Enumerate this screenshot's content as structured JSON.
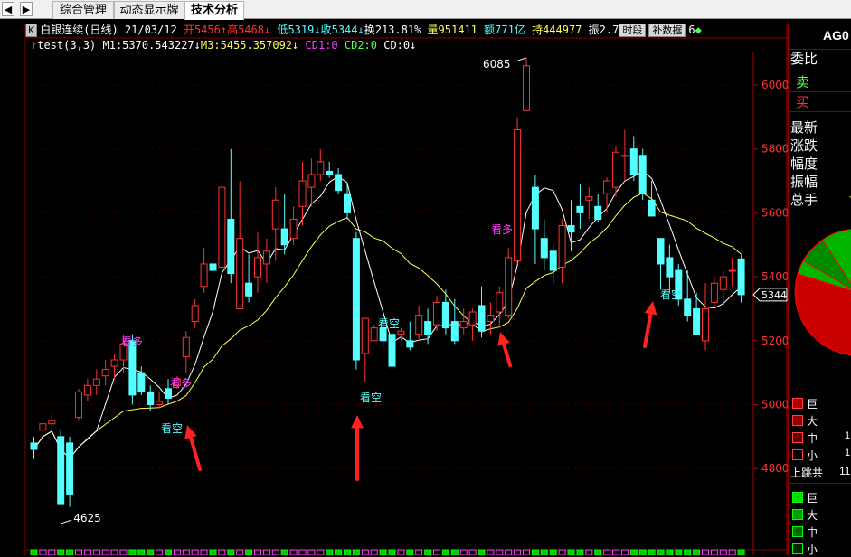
{
  "tabs": {
    "nav_left": "◀",
    "nav_right": "▶",
    "items": [
      {
        "label": "综合管理"
      },
      {
        "label": "动态显示牌"
      },
      {
        "label": "技术分析"
      }
    ]
  },
  "header": {
    "k_badge": "K",
    "instrument": "白银连续(日线)",
    "date": "21/03/12",
    "open": "开5456",
    "high": "高5468",
    "low": "低5319",
    "close": "收5344",
    "turnover_rate": "换213.81%",
    "volume": "量951411",
    "amount": "额771亿",
    "open_interest": "持444977",
    "amplitude": "振2.7",
    "time_btn": "时段",
    "supplement_btn": "补数据",
    "extra": "6"
  },
  "indicator": {
    "name": "test(3,3)",
    "m1": "M1:5370.543227",
    "m3": "M3:5455.357092",
    "cd1": "CD1:0",
    "cd2": "CD2:0",
    "cd": "CD:0"
  },
  "chart": {
    "y_ticks": [
      "6000",
      "5800",
      "5600",
      "5400",
      "5200",
      "5000",
      "4800"
    ],
    "current_price": "5344",
    "max_label": "6085",
    "min_label": "4625",
    "signals": [
      {
        "text": "看多"
      },
      {
        "text": "看空"
      },
      {
        "text": "看多"
      },
      {
        "text": "看空"
      },
      {
        "text": "看空"
      },
      {
        "text": "看多"
      },
      {
        "text": "看空"
      }
    ]
  },
  "right_panel": {
    "code": "AG0",
    "ratio": "委比",
    "sell": "卖",
    "buy": "买",
    "latest": "最新",
    "change": "涨跌",
    "change_pct": "幅度",
    "amplitude": "振幅",
    "total": "总手",
    "legend_red": [
      "巨",
      "大",
      "中",
      "小"
    ],
    "gap_up": "上跳共",
    "gap_up_count": "11",
    "legend_green": [
      "巨",
      "大",
      "中",
      "小"
    ],
    "small_count": "1"
  },
  "colors": {
    "up": "#ff3232",
    "down": "#54ffff",
    "ma_white": "#ffffff",
    "ma_yellow": "#ffff54",
    "signal_long": "#ff40ff",
    "signal_short": "#54ffff",
    "axis": "#b00000"
  }
}
